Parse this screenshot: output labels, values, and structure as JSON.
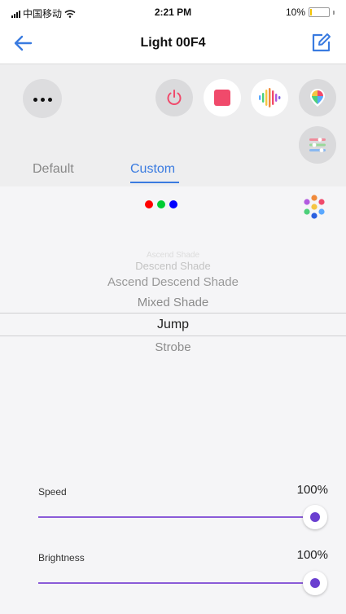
{
  "status_bar": {
    "carrier": "中国移动",
    "time": "2:21 PM",
    "battery_percent": "10%",
    "battery_level": 0.1
  },
  "nav": {
    "title": "Light 00F4",
    "back_icon": "arrow-left-icon",
    "edit_icon": "edit-icon"
  },
  "controls": {
    "buttons": [
      "more-icon",
      "power-icon",
      "stop-icon",
      "music-icon",
      "palette-icon",
      "settings-icon"
    ]
  },
  "tabs": {
    "default_label": "Default",
    "custom_label": "Custom",
    "active": "Custom"
  },
  "colors": {
    "accent": "#3a7be0",
    "slider": "#8a5bd8",
    "dot_red": "#ff0000",
    "dot_green": "#00cc33",
    "dot_blue": "#0000ff"
  },
  "modes": {
    "items": [
      "Ascend Shade",
      "Descend Shade",
      "Ascend Descend Shade",
      "Mixed Shade",
      "Jump",
      "Strobe"
    ],
    "selected": "Jump"
  },
  "speed": {
    "label": "Speed",
    "value": "100%",
    "level": 1.0
  },
  "brightness": {
    "label": "Brightness",
    "value": "100%",
    "level": 1.0
  }
}
